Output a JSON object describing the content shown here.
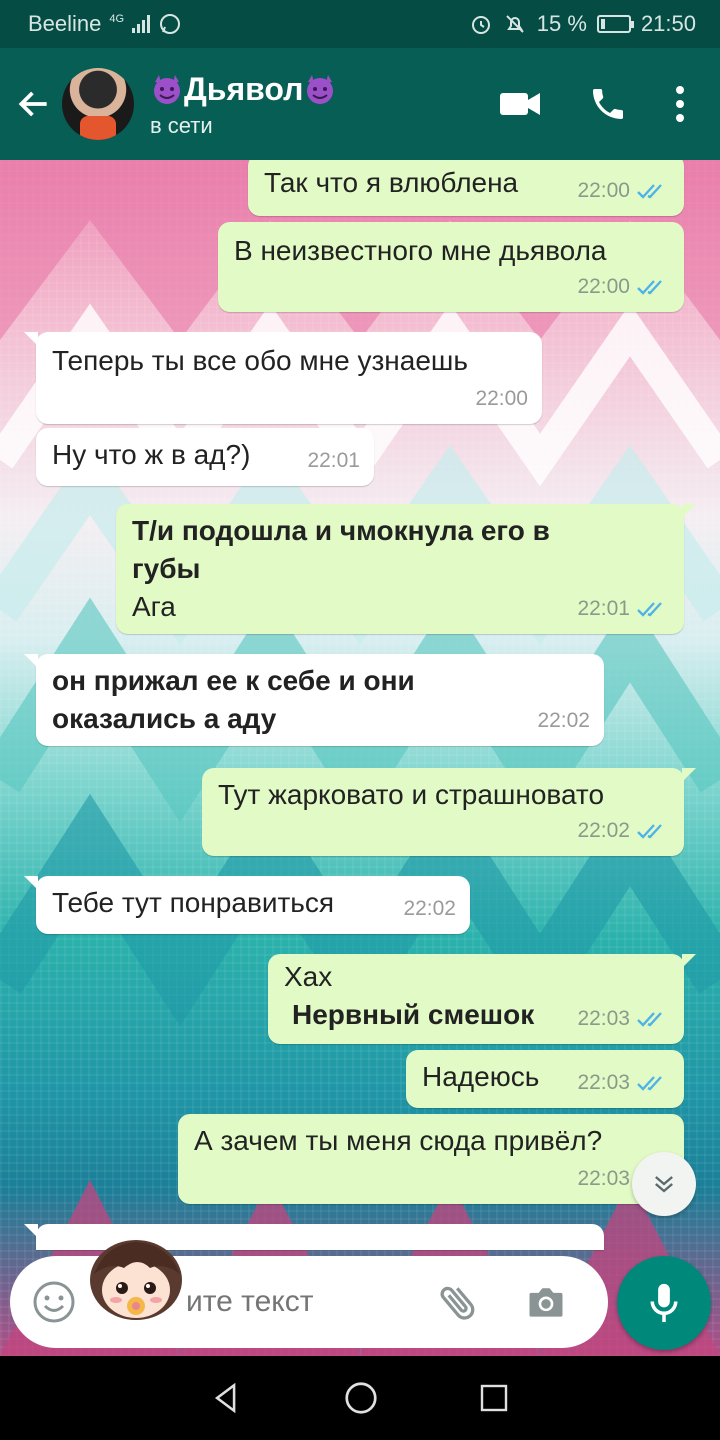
{
  "status_bar": {
    "carrier": "Beeline",
    "network": "4G",
    "battery_percent": "15 %",
    "battery_level": 0.15,
    "time": "21:50"
  },
  "header": {
    "contact_name": "Дьявол",
    "contact_status": "в сети",
    "icons": [
      "back-arrow-icon",
      "video-call-icon",
      "phone-icon",
      "more-vertical-icon"
    ]
  },
  "messages": [
    {
      "dir": "out",
      "text": "Так что я влюблена",
      "time": "22:00",
      "ticks": "read"
    },
    {
      "dir": "out",
      "text": "В неизвестного мне дьявола",
      "time": "22:00",
      "ticks": "read"
    },
    {
      "dir": "in",
      "text": "Теперь ты все обо мне узнаешь",
      "time": "22:00"
    },
    {
      "dir": "in",
      "text": "Ну что ж в ад?)",
      "time": "22:01"
    },
    {
      "dir": "out",
      "bold": "Т/и подошла и чмокнула его в губы",
      "text": "Ага",
      "time": "22:01",
      "ticks": "read"
    },
    {
      "dir": "in",
      "bold": "он прижал ее к себе и они оказались а аду",
      "time": "22:02"
    },
    {
      "dir": "out",
      "text": "Тут жарковато и страшновато",
      "time": "22:02",
      "ticks": "read"
    },
    {
      "dir": "in",
      "text": "Тебе тут понравиться",
      "time": "22:02"
    },
    {
      "dir": "out",
      "text": "Хах",
      "bold": "Нервный смешок",
      "time": "22:03",
      "ticks": "read"
    },
    {
      "dir": "out",
      "text": "Надеюсь",
      "time": "22:03",
      "ticks": "read"
    },
    {
      "dir": "out",
      "text": "А зачем ты меня сюда привёл?",
      "time": "22:03",
      "ticks": "read"
    }
  ],
  "input": {
    "placeholder": "ите текст"
  },
  "colors": {
    "header": "#075e54",
    "status_bar": "#054d44",
    "outgoing_bubble": "#e2fbc6",
    "incoming_bubble": "#ffffff",
    "read_ticks": "#4fb3e8",
    "mic_button": "#00897b"
  }
}
